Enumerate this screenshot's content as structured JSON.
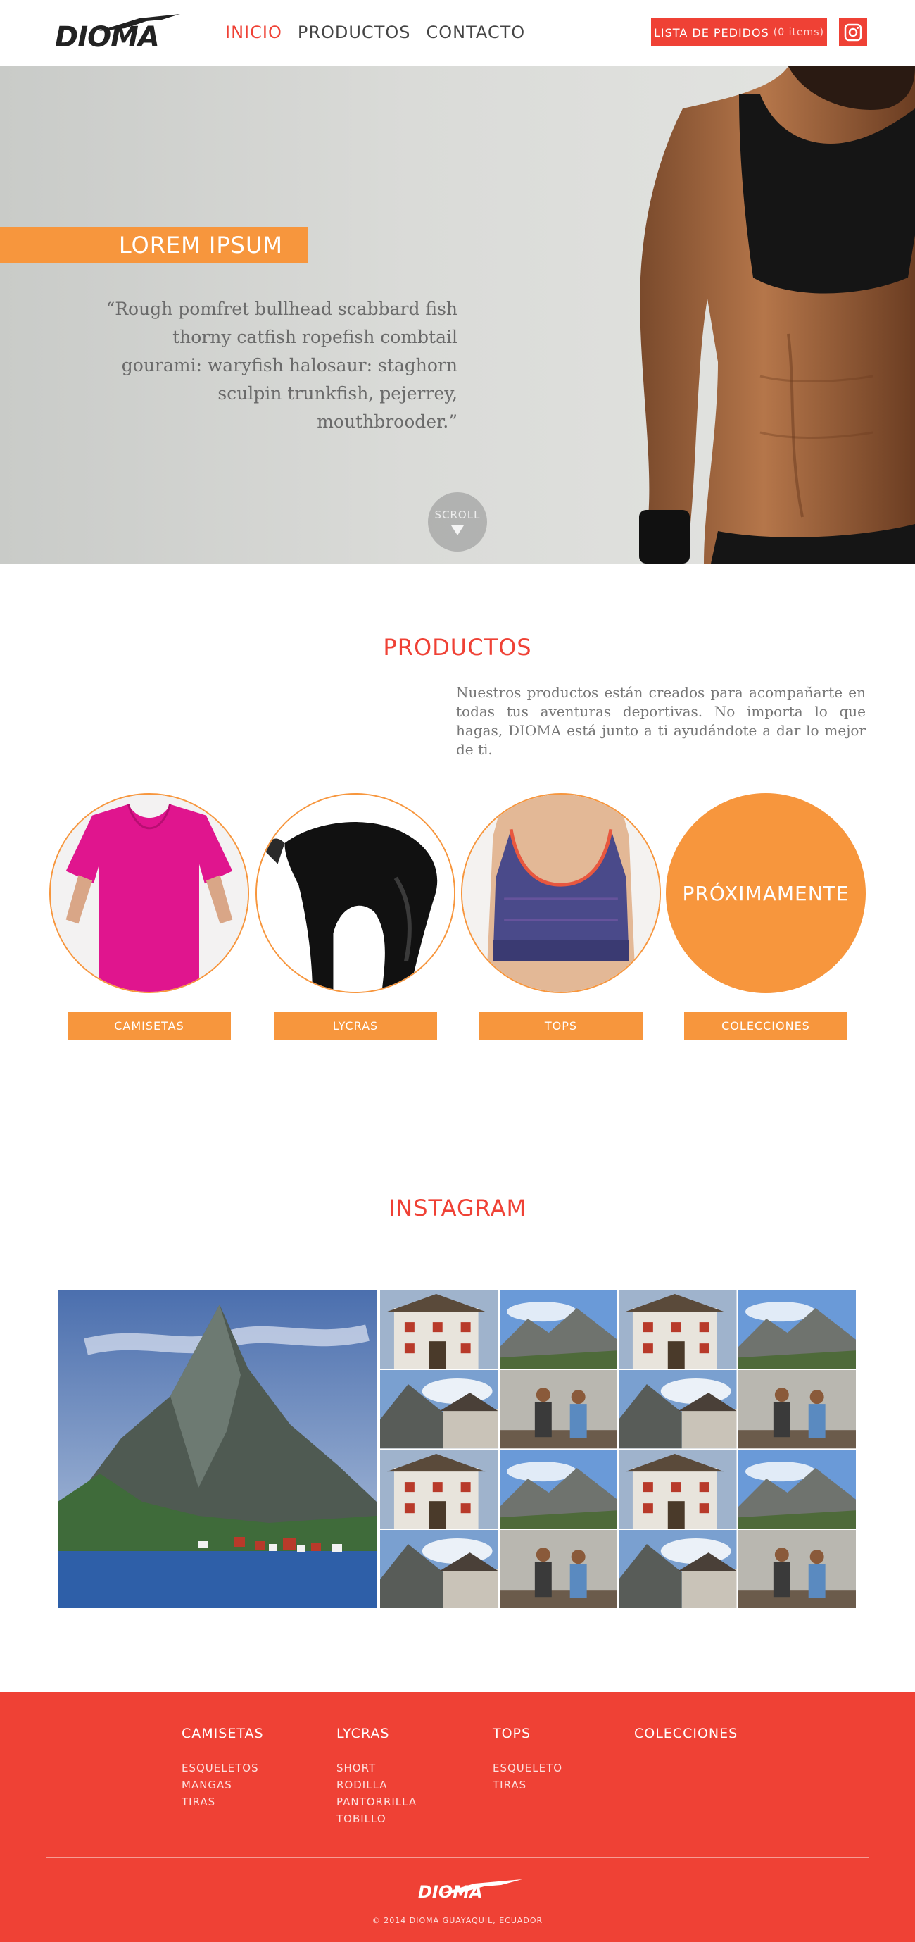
{
  "header": {
    "logo": "DIOMA",
    "nav": [
      {
        "label": "INICIO",
        "active": true
      },
      {
        "label": "PRODUCTOS",
        "active": false
      },
      {
        "label": "CONTACTO",
        "active": false
      }
    ],
    "orders_label": "LISTA DE PEDIDOS",
    "orders_count": "(0 items)",
    "instagram_icon": "instagram-icon"
  },
  "hero": {
    "title": "LOREM IPSUM",
    "quote": "“Rough pomfret bullhead scabbard fish thorny catfish ropefish combtail gourami: waryfish halosaur: staghorn sculpin trunkfish, pejerrey, mouthbrooder.”",
    "scroll_label": "SCROLL"
  },
  "products": {
    "title": "PRODUCTOS",
    "description": "Nuestros productos están creados para acompañarte en todas tus aventuras deportivas. No importa lo que hagas, DIOMA está junto a ti ayudándote a dar lo mejor de ti.",
    "categories": [
      {
        "label": "CAMISETAS",
        "image": "pink-tshirt"
      },
      {
        "label": "LYCRAS",
        "image": "black-lycra"
      },
      {
        "label": "TOPS",
        "image": "sports-top"
      },
      {
        "label": "COLECCIONES",
        "coming_soon": "PRÓXIMAMENTE"
      }
    ]
  },
  "instagram": {
    "title": "INSTAGRAM"
  },
  "footer": {
    "columns": [
      {
        "title": "CAMISETAS",
        "items": [
          "ESQUELETOS",
          "MANGAS",
          "TIRAS"
        ]
      },
      {
        "title": "LYCRAS",
        "items": [
          "SHORT",
          "RODILLA",
          "PANTORRILLA",
          "TOBILLO"
        ]
      },
      {
        "title": "TOPS",
        "items": [
          "ESQUELETO",
          "TIRAS"
        ]
      },
      {
        "title": "COLECCIONES",
        "items": []
      }
    ],
    "logo": "DIOMA",
    "copyright": "© 2014 DIOMA GUAYAQUIL, ECUADOR"
  },
  "colors": {
    "brand_red": "#ef4135",
    "accent_orange": "#f7963d"
  }
}
